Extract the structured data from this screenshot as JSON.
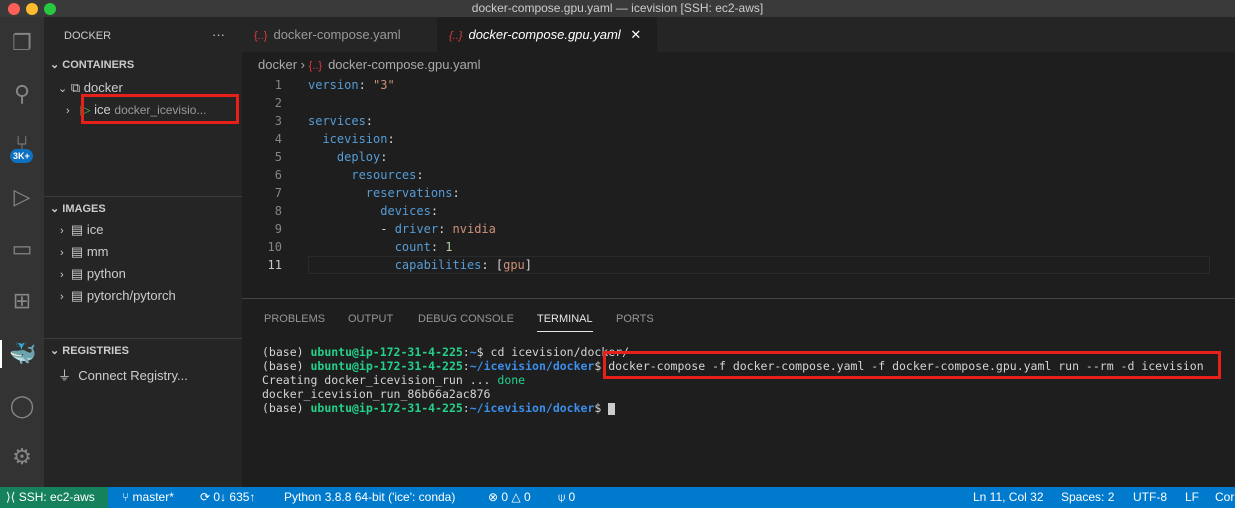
{
  "window": {
    "title": "docker-compose.gpu.yaml — icevision [SSH: ec2-aws]"
  },
  "activity_bar": {
    "badge": "3K+"
  },
  "sidebar": {
    "title": "DOCKER",
    "more": "···",
    "containers": {
      "label": "CONTAINERS",
      "group": "docker",
      "item": {
        "name": "ice",
        "detail": "docker_icevisio..."
      }
    },
    "images": {
      "label": "IMAGES",
      "items": [
        "ice",
        "mm",
        "python",
        "pytorch/pytorch"
      ]
    },
    "registries": {
      "label": "REGISTRIES",
      "items": [
        "Connect Registry..."
      ]
    }
  },
  "tabs": [
    {
      "label": "docker-compose.yaml",
      "active": false
    },
    {
      "label": "docker-compose.gpu.yaml",
      "active": true
    }
  ],
  "breadcrumb": [
    "docker",
    "docker-compose.gpu.yaml"
  ],
  "editor": {
    "lines": [
      {
        "n": "1",
        "parts": [
          [
            "k",
            "version"
          ],
          [
            "p",
            ": "
          ],
          [
            "s",
            "\"3\""
          ]
        ]
      },
      {
        "n": "2",
        "parts": []
      },
      {
        "n": "3",
        "parts": [
          [
            "k",
            "services"
          ],
          [
            "p",
            ":"
          ]
        ]
      },
      {
        "n": "4",
        "parts": [
          [
            "p",
            "  "
          ],
          [
            "k",
            "icevision"
          ],
          [
            "p",
            ":"
          ]
        ]
      },
      {
        "n": "5",
        "parts": [
          [
            "p",
            "    "
          ],
          [
            "k",
            "deploy"
          ],
          [
            "p",
            ":"
          ]
        ]
      },
      {
        "n": "6",
        "parts": [
          [
            "p",
            "      "
          ],
          [
            "k",
            "resources"
          ],
          [
            "p",
            ":"
          ]
        ]
      },
      {
        "n": "7",
        "parts": [
          [
            "p",
            "        "
          ],
          [
            "k",
            "reservations"
          ],
          [
            "p",
            ":"
          ]
        ]
      },
      {
        "n": "8",
        "parts": [
          [
            "p",
            "          "
          ],
          [
            "k",
            "devices"
          ],
          [
            "p",
            ":"
          ]
        ]
      },
      {
        "n": "9",
        "parts": [
          [
            "p",
            "          - "
          ],
          [
            "k",
            "driver"
          ],
          [
            "p",
            ": "
          ],
          [
            "s",
            "nvidia"
          ]
        ]
      },
      {
        "n": "10",
        "parts": [
          [
            "p",
            "            "
          ],
          [
            "k",
            "count"
          ],
          [
            "p",
            ": "
          ],
          [
            "n",
            "1"
          ]
        ]
      },
      {
        "n": "11",
        "parts": [
          [
            "p",
            "            "
          ],
          [
            "k",
            "capabilities"
          ],
          [
            "p",
            ": ["
          ],
          [
            "s",
            "gpu"
          ],
          [
            "p",
            "]"
          ]
        ]
      }
    ]
  },
  "panel": {
    "tabs": [
      "PROBLEMS",
      "OUTPUT",
      "DEBUG CONSOLE",
      "TERMINAL",
      "PORTS"
    ],
    "active": "TERMINAL"
  },
  "terminal": {
    "lines": [
      [
        [
          "p",
          "(base) "
        ],
        [
          "g",
          "ubuntu@ip-172-31-4-225"
        ],
        [
          "p",
          ":"
        ],
        [
          "b",
          "~"
        ],
        [
          "p",
          "$ cd icevision/docker/"
        ]
      ],
      [
        [
          "p",
          "(base) "
        ],
        [
          "g",
          "ubuntu@ip-172-31-4-225"
        ],
        [
          "p",
          ":"
        ],
        [
          "b",
          "~/icevision/docker"
        ],
        [
          "p",
          "$ docker-compose -f docker-compose.yaml -f docker-compose.gpu.yaml run --rm -d icevision"
        ]
      ],
      [
        [
          "p",
          "Creating docker_icevision_run ... "
        ],
        [
          "gn",
          "done"
        ]
      ],
      [
        [
          "p",
          "docker_icevision_run_86b66a2ac876"
        ]
      ],
      [
        [
          "p",
          "(base) "
        ],
        [
          "g",
          "ubuntu@ip-172-31-4-225"
        ],
        [
          "p",
          ":"
        ],
        [
          "b",
          "~/icevision/docker"
        ],
        [
          "p",
          "$ "
        ]
      ]
    ]
  },
  "status_bar": {
    "left": [
      "SSH: ec2-aws",
      "master*",
      "0↓ 635↑",
      "Python 3.8.8 64-bit ('ice': conda)",
      "⊗ 0 △ 0",
      "0"
    ],
    "right": [
      "Ln 11, Col 32",
      "Spaces: 2",
      "UTF-8",
      "LF",
      "Cor"
    ]
  }
}
